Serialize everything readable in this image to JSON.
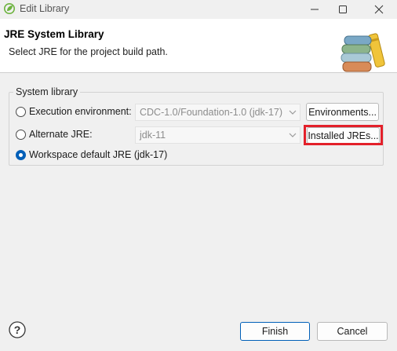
{
  "window": {
    "title": "Edit Library",
    "minimize_icon": "minimize-icon",
    "maximize_icon": "maximize-icon",
    "close_icon": "close-icon",
    "app_icon": "spring-leaf-icon"
  },
  "header": {
    "title": "JRE System Library",
    "description": "Select JRE for the project build path.",
    "banner_icon": "library-books-icon"
  },
  "system_library": {
    "legend": "System library",
    "options": [
      {
        "label": "Execution environment:",
        "selected": false,
        "combo_value": "CDC-1.0/Foundation-1.0 (jdk-17)",
        "combo_enabled": false,
        "button_label": "Environments..."
      },
      {
        "label": "Alternate JRE:",
        "selected": false,
        "combo_value": "jdk-11",
        "combo_enabled": false,
        "button_label": "Installed JREs...",
        "button_highlighted": true,
        "highlight_color": "#e3202a"
      },
      {
        "label": "Workspace default JRE (jdk-17)",
        "selected": true
      }
    ]
  },
  "footer": {
    "help_icon": "help-icon",
    "finish_label": "Finish",
    "cancel_label": "Cancel"
  },
  "colors": {
    "accent": "#005fb8",
    "background": "#f0f0f0",
    "header_background": "#ffffff"
  }
}
